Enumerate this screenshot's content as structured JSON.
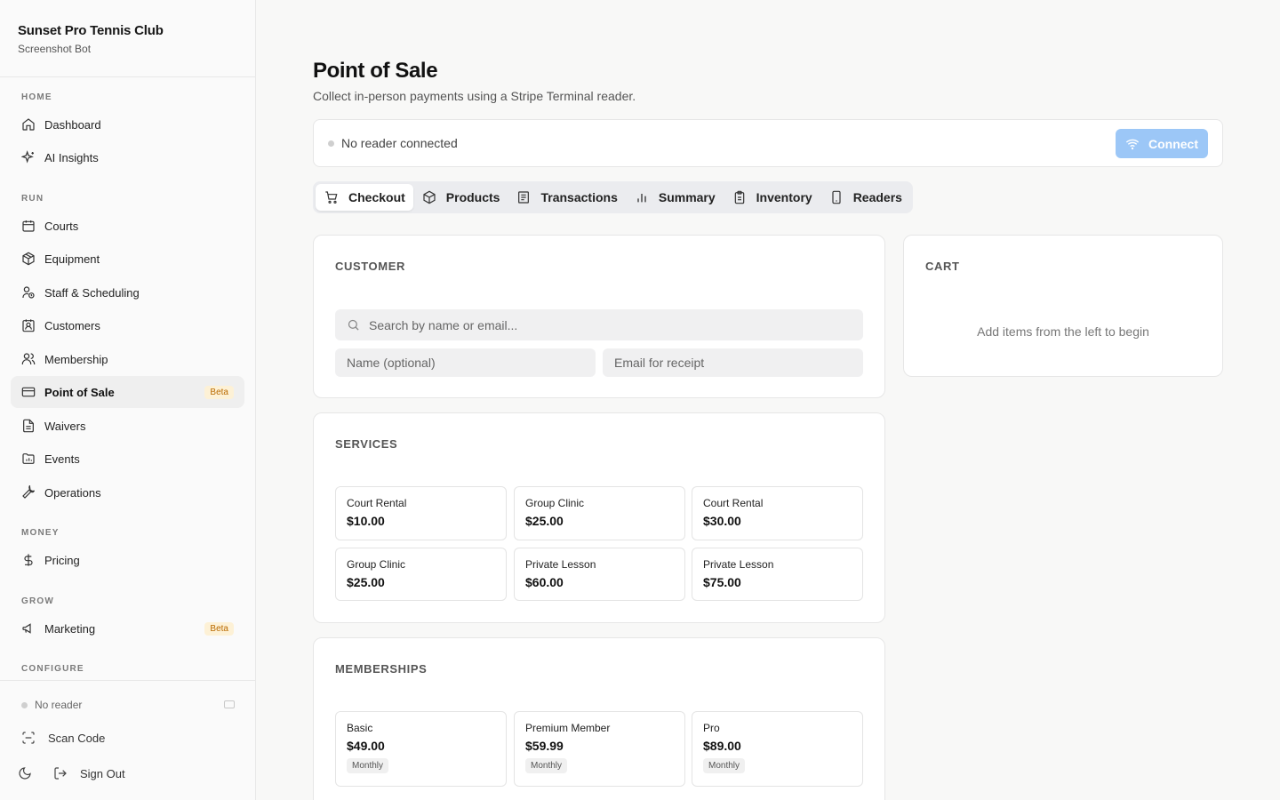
{
  "sidebar": {
    "brand_name": "Sunset Pro Tennis Club",
    "brand_sub": "Screenshot Bot",
    "sections": {
      "home": "HOME",
      "run": "RUN",
      "money": "MONEY",
      "grow": "GROW",
      "configure": "CONFIGURE"
    },
    "items": {
      "dashboard": "Dashboard",
      "ai_insights": "AI Insights",
      "courts": "Courts",
      "equipment": "Equipment",
      "staff": "Staff & Scheduling",
      "customers": "Customers",
      "membership": "Membership",
      "pos": "Point of Sale",
      "waivers": "Waivers",
      "events": "Events",
      "operations": "Operations",
      "pricing": "Pricing",
      "marketing": "Marketing"
    },
    "beta_label": "Beta",
    "footer": {
      "reader_status": "No reader",
      "scan_code": "Scan Code",
      "sign_out": "Sign Out"
    }
  },
  "main": {
    "title": "Point of Sale",
    "subtitle": "Collect in-person payments using a Stripe Terminal reader.",
    "reader": {
      "status": "No reader connected",
      "connect_label": "Connect"
    },
    "tabs": [
      "Checkout",
      "Products",
      "Transactions",
      "Summary",
      "Inventory",
      "Readers"
    ],
    "customer": {
      "title": "CUSTOMER",
      "search_placeholder": "Search by name or email...",
      "name_placeholder": "Name (optional)",
      "email_placeholder": "Email for receipt"
    },
    "services": {
      "title": "SERVICES",
      "items": [
        {
          "name": "Court Rental",
          "price": "$10.00"
        },
        {
          "name": "Group Clinic",
          "price": "$25.00"
        },
        {
          "name": "Court Rental",
          "price": "$30.00"
        },
        {
          "name": "Group Clinic",
          "price": "$25.00"
        },
        {
          "name": "Private Lesson",
          "price": "$60.00"
        },
        {
          "name": "Private Lesson",
          "price": "$75.00"
        }
      ]
    },
    "memberships": {
      "title": "MEMBERSHIPS",
      "items": [
        {
          "name": "Basic",
          "price": "$49.00",
          "period": "Monthly"
        },
        {
          "name": "Premium Member",
          "price": "$59.99",
          "period": "Monthly"
        },
        {
          "name": "Pro",
          "price": "$89.00",
          "period": "Monthly"
        }
      ]
    },
    "cart": {
      "title": "CART",
      "empty_text": "Add items from the left to begin"
    }
  },
  "colors": {
    "accent": "#9cc7f7",
    "beta_text": "#b96a00",
    "beta_bg": "#fdf1d6"
  }
}
